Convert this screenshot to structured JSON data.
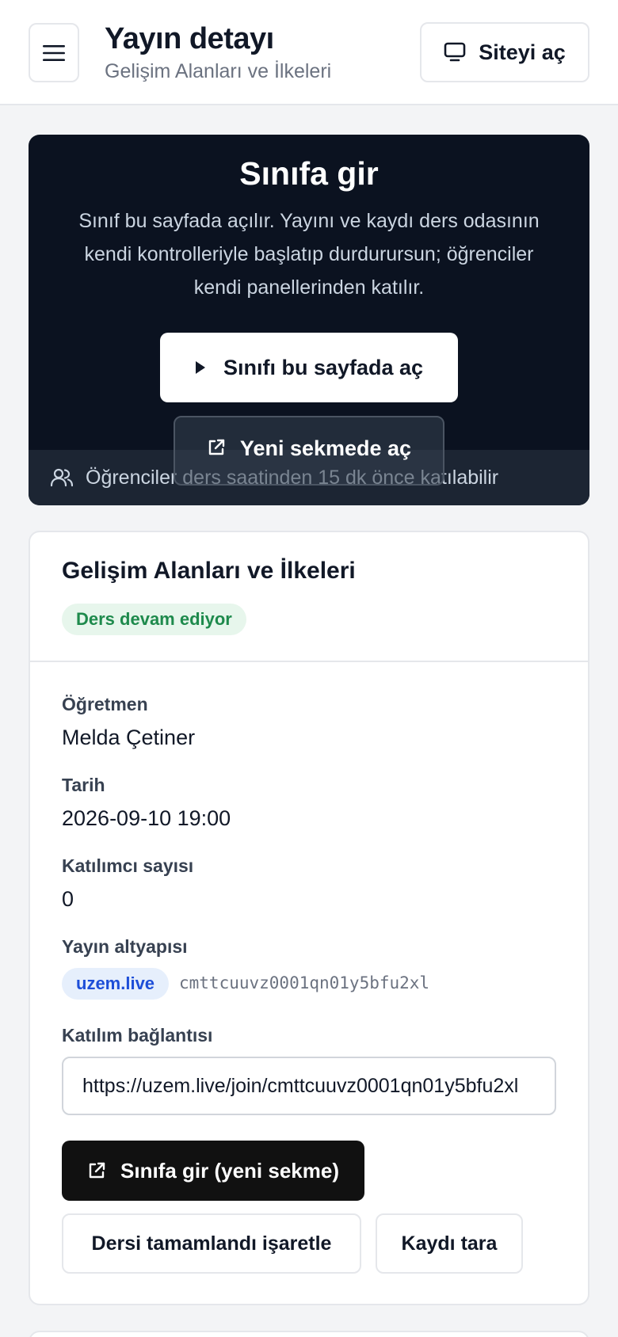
{
  "header": {
    "title": "Yayın detayı",
    "subtitle": "Gelişim Alanları ve İlkeleri",
    "site_button_label": "Siteyi aç"
  },
  "hero": {
    "title": "Sınıfa gir",
    "description": "Sınıf bu sayfada açılır. Yayını ve kaydı ders odasının kendi kontrolleriyle başlatıp durdurursun; öğrenciler kendi panellerinden katılır.",
    "primary_button_label": "Sınıfı bu sayfada aç",
    "secondary_button_label": "Yeni sekmede aç",
    "footer_note": "Öğrenciler ders saatinden 15 dk önce katılabilir"
  },
  "detail": {
    "title": "Gelişim Alanları ve İlkeleri",
    "status_badge": "Ders devam ediyor",
    "fields": {
      "teacher_label": "Öğretmen",
      "teacher_value": "Melda Çetiner",
      "date_label": "Tarih",
      "date_value": "2026-09-10 19:00",
      "participants_label": "Katılımcı sayısı",
      "participants_value": "0",
      "infra_label": "Yayın altyapısı",
      "infra_badge": "uzem.live",
      "infra_id": "cmttcuuvz0001qn01y5bfu2xl",
      "join_link_label": "Katılım bağlantısı",
      "join_link_value": "https://uzem.live/join/cmttcuuvz0001qn01y5bfu2xl"
    },
    "enter_button_label": "Sınıfa gir (yeni sekme)",
    "mark_done_button_label": "Dersi tamamlandı işaretle",
    "scan_recording_button_label": "Kaydı tara"
  },
  "colors": {
    "hero_bg": "#0b1220",
    "status_green": "#1e8a4c",
    "infra_blue": "#1d4ed8",
    "primary_dark": "#111111"
  },
  "icons": {
    "menu": "menu-icon",
    "site": "monitor-icon",
    "play": "play-icon",
    "external": "external-link-icon",
    "users": "users-icon"
  }
}
